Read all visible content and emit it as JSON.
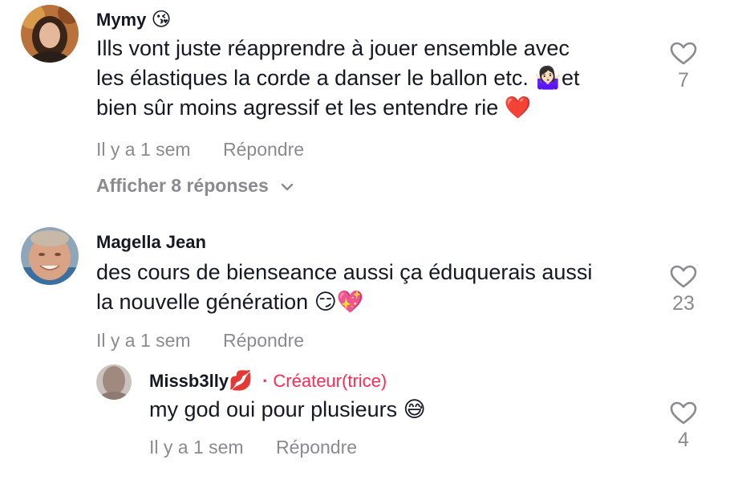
{
  "comments": [
    {
      "username": "Mymy",
      "username_emoji": "😘",
      "text_lines": [
        "Ills vont juste réapprendre à jouer ensemble avec",
        "les élastiques la corde a danser le ballon etc. 🤷🏻‍♀️et",
        "bien sûr moins agressif et les entendre rie ❤️"
      ],
      "time": "Il y a 1 sem",
      "reply_label": "Répondre",
      "likes": "7",
      "view_replies": "Afficher 8 réponses"
    },
    {
      "username": "Magella Jean",
      "text_lines": [
        "des cours de bienseance aussi ça éduquerais aussi",
        "la nouvelle génération 😏💖"
      ],
      "time": "Il y a 1 sem",
      "reply_label": "Répondre",
      "likes": "23"
    }
  ],
  "reply": {
    "username": "Missb3lly",
    "username_emoji": "💋",
    "creator_separator": "·",
    "creator_label": "Créateur(trice)",
    "text": "my god oui pour plusieurs 😅",
    "time": "Il y a 1 sem",
    "reply_label": "Répondre",
    "likes": "4"
  },
  "colors": {
    "primary_text": "#161823",
    "secondary_text": "#8a8b91",
    "creator_accent": "#fe2c55",
    "background": "#ffffff"
  },
  "icons": {
    "like": "heart-outline-icon",
    "expand": "chevron-down-icon"
  }
}
